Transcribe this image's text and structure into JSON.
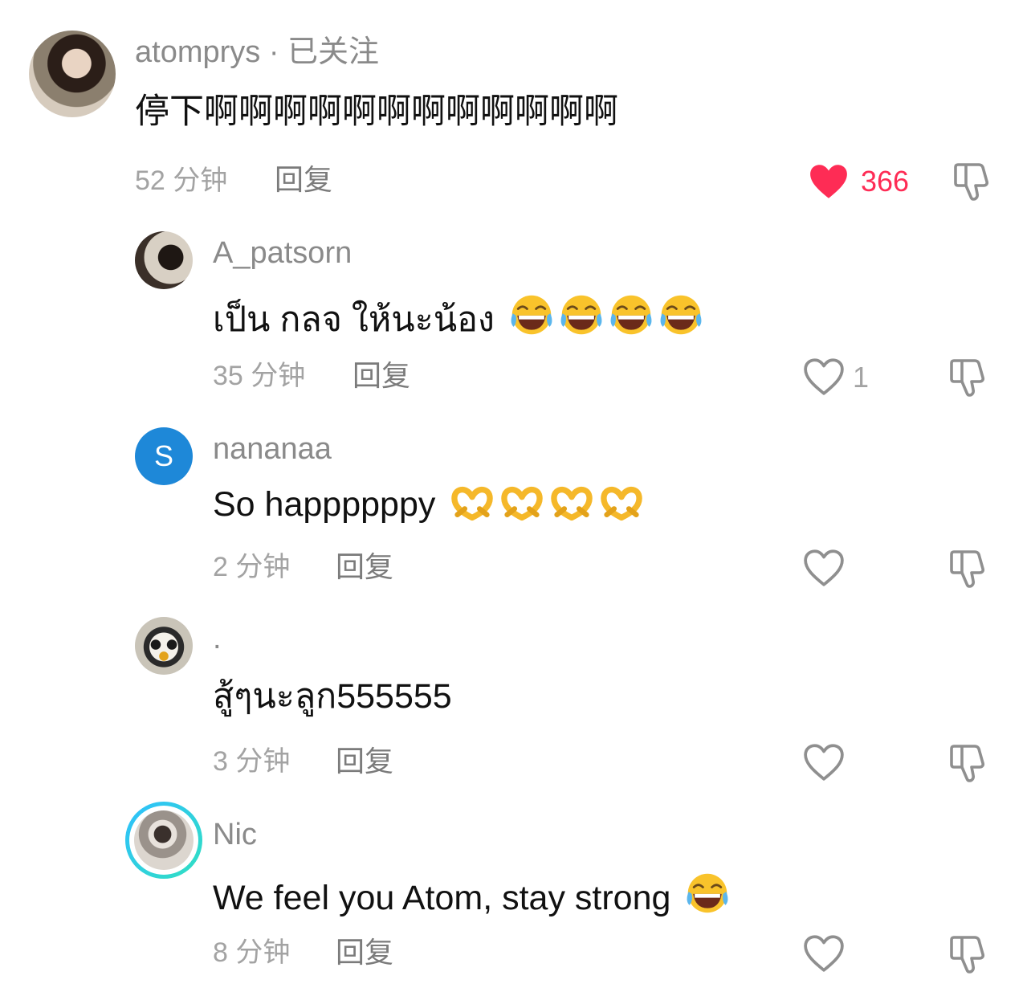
{
  "colors": {
    "like_active": "#fe2c55",
    "muted": "#a3a3a3"
  },
  "comments": [
    {
      "username": "atomprys",
      "follow_status": "· 已关注",
      "text": "停下啊啊啊啊啊啊啊啊啊啊啊啊",
      "time": "52 分钟",
      "reply_label": "回复",
      "likes": "366",
      "liked": true
    },
    {
      "username": "A_patsorn",
      "text": "เป็น กลจ ให้นะน้อง",
      "emoji": "face-with-tears-of-joy",
      "time": "35 分钟",
      "reply_label": "回复",
      "likes": "1",
      "liked": false
    },
    {
      "username": "nananaa",
      "avatar_letter": "S",
      "text": "So happppppy",
      "emoji": "heart-hands",
      "time": "2 分钟",
      "reply_label": "回复",
      "liked": false
    },
    {
      "username": ".",
      "text": "สู้ๆนะลูก555555",
      "time": "3 分钟",
      "reply_label": "回复",
      "liked": false
    },
    {
      "username": "Nic",
      "text": "We feel you Atom, stay strong",
      "emoji": "face-with-tears-of-joy",
      "time": "8 分钟",
      "reply_label": "回复",
      "liked": false
    }
  ]
}
